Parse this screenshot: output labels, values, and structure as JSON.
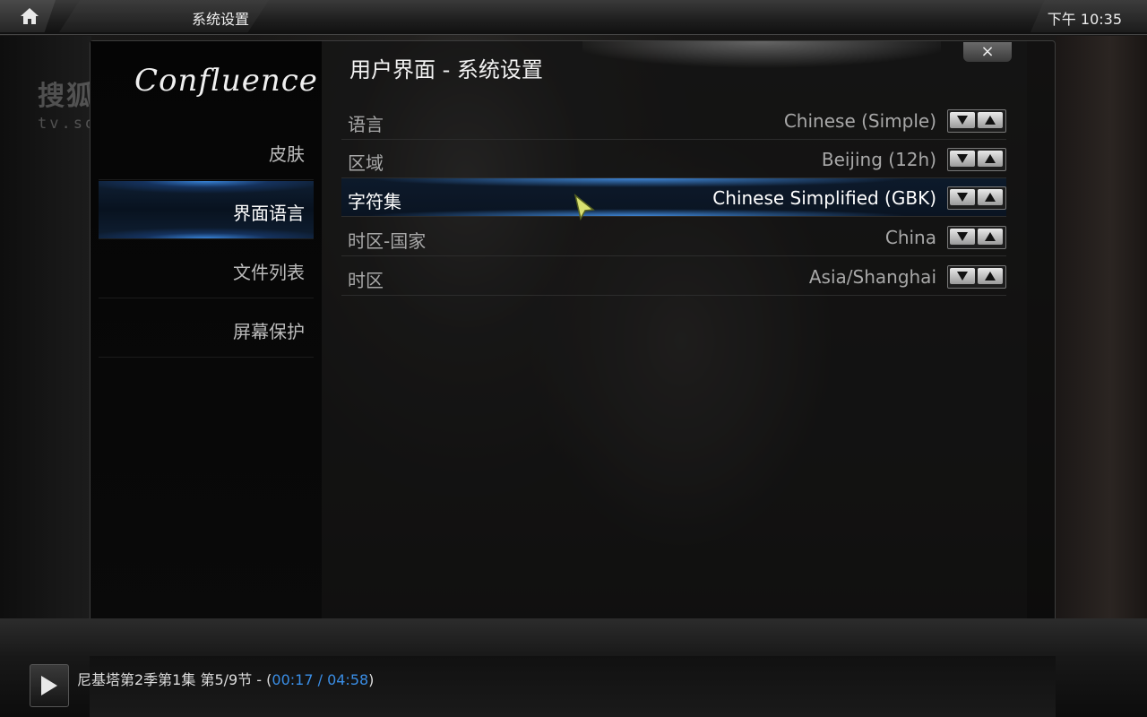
{
  "header": {
    "breadcrumb": "系统设置",
    "clock": "下午 10:35"
  },
  "logo": "Confluence",
  "watermark": {
    "line1": "搜狐视频",
    "line2": "tv.sohu.com"
  },
  "sidebar": {
    "items": [
      {
        "label": "皮肤",
        "active": false
      },
      {
        "label": "界面语言",
        "active": true
      },
      {
        "label": "文件列表",
        "active": false
      },
      {
        "label": "屏幕保护",
        "active": false
      }
    ]
  },
  "content": {
    "title": "用户界面 - 系统设置",
    "close_label": "×",
    "settings": [
      {
        "label": "语言",
        "value": "Chinese (Simple)"
      },
      {
        "label": "区域",
        "value": "Beijing (12h)"
      },
      {
        "label": "字符集",
        "value": "Chinese Simplified (GBK)"
      },
      {
        "label": "时区-国家",
        "value": "China"
      },
      {
        "label": "时区",
        "value": "Asia/Shanghai"
      }
    ]
  },
  "player": {
    "title": "尼基塔第2季第1集 第5/9节 - (",
    "time": "00:17 / 04:58",
    "suffix": ")"
  },
  "icons": {
    "home": "home-icon",
    "play": "play-icon",
    "close": "close-icon",
    "down": "arrow-down-icon",
    "up": "arrow-up-icon"
  }
}
